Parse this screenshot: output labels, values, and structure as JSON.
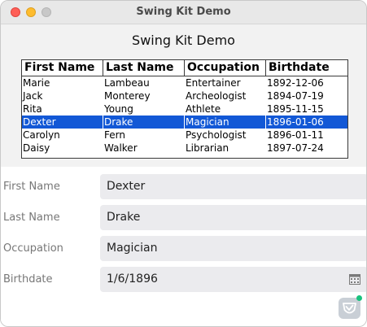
{
  "window": {
    "title": "Swing Kit Demo"
  },
  "heading": "Swing Kit Demo",
  "table": {
    "columns": [
      "First Name",
      "Last Name",
      "Occupation",
      "Birthdate"
    ],
    "rows": [
      [
        "Marie",
        "Lambeau",
        "Entertainer",
        "1892-12-06"
      ],
      [
        "Jack",
        "Monterey",
        "Archeologist",
        "1894-07-19"
      ],
      [
        "Rita",
        "Young",
        "Athlete",
        "1895-11-15"
      ],
      [
        "Dexter",
        "Drake",
        "Magician",
        "1896-01-06"
      ],
      [
        "Carolyn",
        "Fern",
        "Psychologist",
        "1896-01-11"
      ],
      [
        "Daisy",
        "Walker",
        "Librarian",
        "1897-07-24"
      ]
    ],
    "selected_row_label": "Dexter"
  },
  "form": {
    "first_name": {
      "label": "First Name",
      "value": "Dexter"
    },
    "last_name": {
      "label": "Last Name",
      "value": "Drake"
    },
    "occupation": {
      "label": "Occupation",
      "value": "Magician"
    },
    "birthdate": {
      "label": "Birthdate",
      "value": "1/6/1896"
    }
  },
  "icons": {
    "calendar": "calendar-icon",
    "app_badge": "shield-check-icon"
  },
  "colors": {
    "selection": "#1258d6",
    "badge_dot": "#19c27e"
  }
}
